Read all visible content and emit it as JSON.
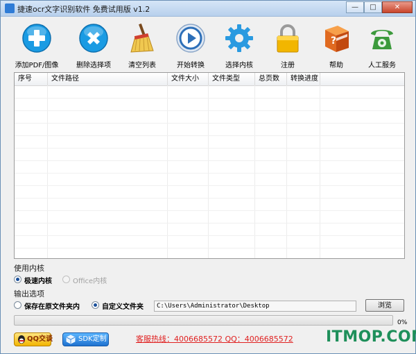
{
  "window": {
    "title": "捷速ocr文字识别软件 免费试用版 v1.2",
    "controls": {
      "minimize": "—",
      "maximize": "□",
      "close": "✕"
    }
  },
  "toolbar": {
    "items": [
      {
        "label": "添加PDF/图像",
        "icon": "add-icon",
        "color": "#1a9be3"
      },
      {
        "label": "删除选择项",
        "icon": "delete-icon",
        "color": "#1a9be3"
      },
      {
        "label": "清空列表",
        "icon": "broom-icon",
        "color": "#e0b040"
      },
      {
        "label": "开始转换",
        "icon": "play-icon",
        "color": "#2d6fb8"
      },
      {
        "label": "选择内核",
        "icon": "gear-icon",
        "color": "#2a9ae0"
      },
      {
        "label": "注册",
        "icon": "lock-icon",
        "color": "#f0b400"
      },
      {
        "label": "帮助",
        "icon": "help-book-icon",
        "color": "#e06a20"
      },
      {
        "label": "人工服务",
        "icon": "phone-icon",
        "color": "#3c9a3c"
      }
    ]
  },
  "file_list": {
    "columns": [
      "序号",
      "文件路径",
      "文件大小",
      "文件类型",
      "总页数",
      "转换进度"
    ],
    "rows": []
  },
  "engine": {
    "section_label": "使用内核",
    "options": [
      {
        "label": "极速内核",
        "selected": true,
        "enabled": true
      },
      {
        "label": "Office内核",
        "selected": false,
        "enabled": false
      }
    ]
  },
  "output": {
    "section_label": "输出选项",
    "options": [
      {
        "label": "保存在原文件夹内",
        "selected": false
      },
      {
        "label": "自定义文件夹",
        "selected": true
      }
    ],
    "path_value": "C:\\Users\\Administrator\\Desktop",
    "browse_label": "浏览"
  },
  "progress": {
    "value_fraction": 0.0,
    "text": "0%",
    "fill_color": "#3cb043"
  },
  "footer": {
    "qq_label": "QQ交谈",
    "sdk_label": "SDK定制",
    "hotline": "客服热线：4006685572 QQ：4006685572",
    "watermark": "ITMOP.COM"
  }
}
